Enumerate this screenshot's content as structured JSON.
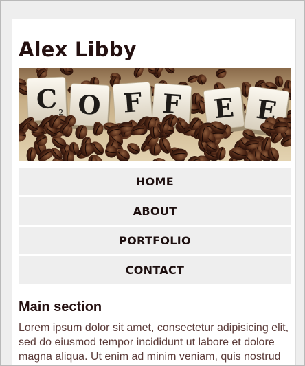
{
  "site": {
    "title": "Alex Libby"
  },
  "hero": {
    "alt": "Coffee",
    "tiles": [
      "C",
      "O",
      "F",
      "F",
      "E",
      "E"
    ],
    "subscript": "2",
    "colors": {
      "background": "#d9c7a1",
      "bean": "#4a2414",
      "tile": "#f3eee2",
      "letter": "#1e1b18"
    }
  },
  "nav": {
    "items": [
      {
        "label": "HOME"
      },
      {
        "label": "ABOUT"
      },
      {
        "label": "PORTFOLIO"
      },
      {
        "label": "CONTACT"
      }
    ]
  },
  "main": {
    "heading": "Main section",
    "body": "Lorem ipsum dolor sit amet, consectetur adipisicing elit, sed do eiusmod tempor incididunt ut labore et dolore magna aliqua. Ut enim ad minim veniam, quis nostrud"
  },
  "colors": {
    "title": "#241010",
    "nav_bg": "#eeeeee",
    "body_text": "#5a3a38",
    "page_bg": "#ffffff",
    "outer_bg": "#eeeeee"
  }
}
